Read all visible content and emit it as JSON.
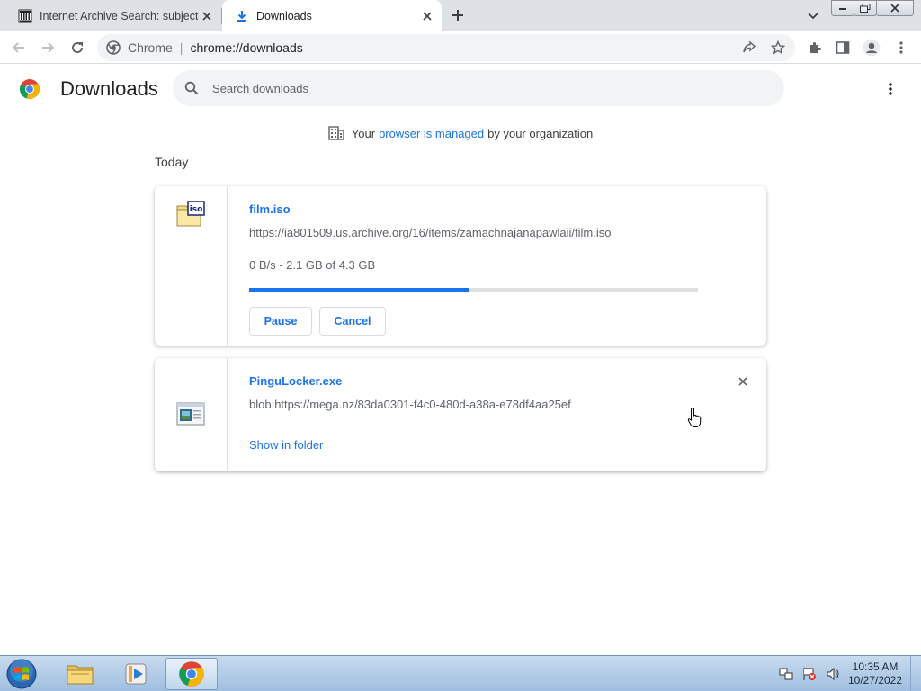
{
  "tabs": [
    {
      "title": "Internet Archive Search: subject:\"",
      "favicon": "archive-icon"
    },
    {
      "title": "Downloads",
      "favicon": "download-icon"
    }
  ],
  "toolbar": {
    "site_label": "Chrome",
    "url": "chrome://downloads"
  },
  "header": {
    "title": "Downloads",
    "search_placeholder": "Search downloads"
  },
  "managed": {
    "before": "Your",
    "link": "browser is managed",
    "after": "by your organization"
  },
  "section": "Today",
  "downloads": [
    {
      "name": "film.iso",
      "url": "https://ia801509.us.archive.org/16/items/zamachnajanapawlaii/film.iso",
      "status": "0 B/s - 2.1 GB of 4.3 GB",
      "progress": 0.49,
      "pause_label": "Pause",
      "cancel_label": "Cancel",
      "icon": "iso-file-icon"
    },
    {
      "name": "PinguLocker.exe",
      "url": "blob:https://mega.nz/83da0301-f4c0-480d-a38a-e78df4aa25ef",
      "show_label": "Show in folder",
      "icon": "exe-file-icon"
    }
  ],
  "taskbar": {
    "time": "10:35 AM",
    "date": "10/27/2022"
  },
  "colors": {
    "accent": "#1a73e8",
    "tabstrip": "#dee1e6"
  }
}
